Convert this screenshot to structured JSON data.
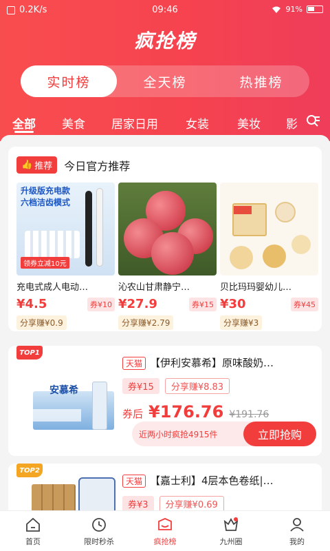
{
  "status": {
    "speed": "0.2K/s",
    "time": "09:46",
    "battery": "91%"
  },
  "app_title": "疯抢榜",
  "segments": [
    {
      "label": "实时榜",
      "active": true
    },
    {
      "label": "全天榜",
      "active": false
    },
    {
      "label": "热推榜",
      "active": false
    }
  ],
  "categories": [
    {
      "label": "全部"
    },
    {
      "label": "美食"
    },
    {
      "label": "居家日用"
    },
    {
      "label": "女装"
    },
    {
      "label": "美妆"
    },
    {
      "label": "影"
    }
  ],
  "recommend": {
    "badge": "推荐",
    "title": "今日官方推荐",
    "items": [
      {
        "name": "充电式成人电动…",
        "price": "¥4.5",
        "coupon": "券¥10",
        "share": "分享赚¥0.9",
        "img_text_1": "升级版充电款",
        "img_text_2": "六档洁齿模式",
        "img_tag": "领券立减10元"
      },
      {
        "name": "沁农山甘肃静宁…",
        "price": "¥27.9",
        "coupon": "券¥15",
        "share": "分享赚¥2.79"
      },
      {
        "name": "贝比玛玛婴幼儿…",
        "price": "¥30",
        "coupon": "券¥45",
        "share": "分享赚¥3"
      }
    ]
  },
  "products": [
    {
      "rank": "TOP1",
      "platform": "天猫",
      "title": "【伊利安慕希】原味酸奶…",
      "coupon": "券¥15",
      "share": "分享赚¥8.83",
      "after_label": "券后",
      "after_price": "¥176.76",
      "orig_price": "¥191.76",
      "note": "近两小时疯抢4915件",
      "buy_label": "立即抢购",
      "img_brand": "安慕希"
    },
    {
      "rank": "TOP2",
      "platform": "天猫",
      "title": "【嘉士利】4层本色卷纸|…",
      "coupon": "券¥3",
      "share": "分享赚¥0.69"
    }
  ],
  "tabs": [
    {
      "label": "首页",
      "icon": "home-icon"
    },
    {
      "label": "限时秒杀",
      "icon": "flash-sale-icon"
    },
    {
      "label": "疯抢榜",
      "icon": "ranking-icon",
      "active": true
    },
    {
      "label": "九州圈",
      "icon": "community-icon"
    },
    {
      "label": "我的",
      "icon": "profile-icon"
    }
  ]
}
